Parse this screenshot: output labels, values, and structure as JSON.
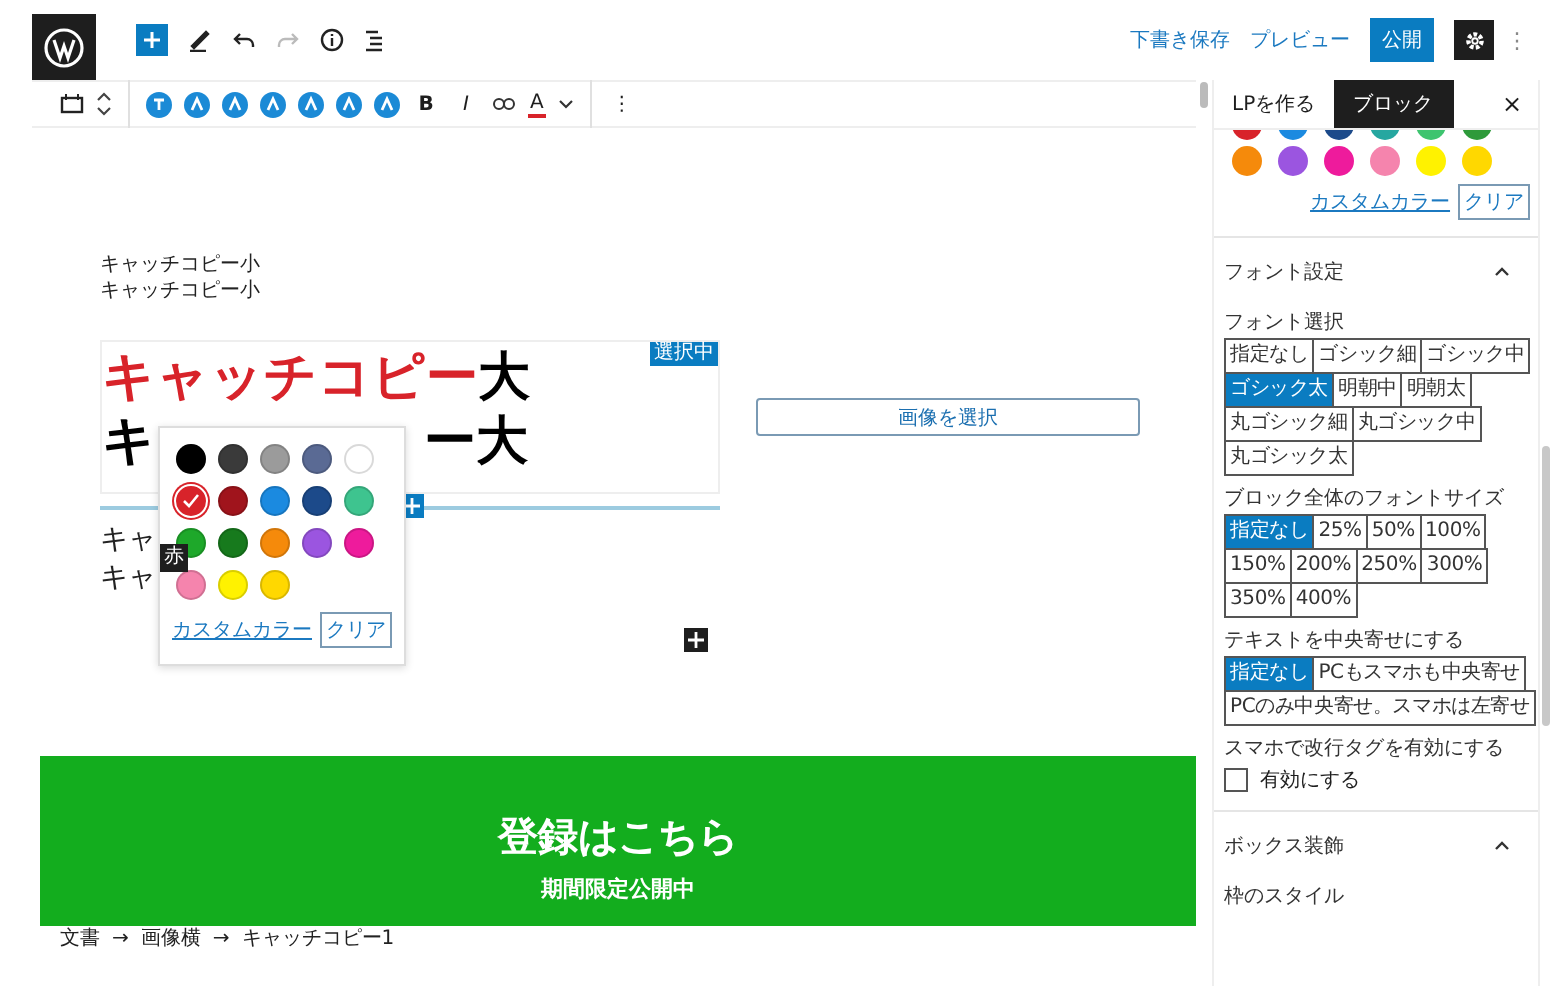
{
  "header": {
    "links": [
      "下書き保存",
      "プレビュー"
    ],
    "publish_button": "公開",
    "more_button": "⋮"
  },
  "toolbar": {
    "format_buttons": [
      {
        "label": "B",
        "kind": "bold"
      },
      {
        "label": "I",
        "kind": "italic"
      }
    ],
    "text_color_button": "A",
    "more_button": "⋮"
  },
  "editor": {
    "small_lines": [
      "キャッチコピー小",
      "キャッチコピー小"
    ],
    "heading": {
      "badge": "選択中",
      "lines": [
        {
          "kind": "full",
          "segments": [
            {
              "text": "キャッチコピー",
              "color": "#d8232a"
            },
            {
              "text": "大"
            }
          ]
        },
        {
          "kind": "covered",
          "segments": [
            {
              "text": "キ"
            },
            {
              "text": "ー大"
            }
          ]
        }
      ]
    },
    "image_button": "画像を選択",
    "lower_lines": [
      "キャ",
      "キャ"
    ],
    "banner": {
      "title": "登録はこちら",
      "subtitle": "期間限定公開中"
    }
  },
  "color_popover": {
    "swatches": [
      {
        "color": "#000000",
        "selected": false
      },
      {
        "color": "#3a3a3a",
        "selected": false
      },
      {
        "color": "#9b9b9b",
        "selected": false
      },
      {
        "color": "#5a6a94",
        "selected": false
      },
      {
        "color": "#ffffff",
        "selected": false
      },
      {
        "color": "#d8232a",
        "selected": true
      },
      {
        "color": "#a0141c",
        "selected": false
      },
      {
        "color": "#1b8ae0",
        "selected": false
      },
      {
        "color": "#1c4a8a",
        "selected": false
      },
      {
        "color": "#3ec48f",
        "selected": false
      },
      {
        "color": "#1ea82a",
        "selected": false
      },
      {
        "color": "#177a1d",
        "selected": false
      },
      {
        "color": "#f58a0b",
        "selected": false
      },
      {
        "color": "#9b55e0",
        "selected": false
      },
      {
        "color": "#ee1b9c",
        "selected": false
      },
      {
        "color": "#f584ad",
        "selected": false
      },
      {
        "color": "#fff200",
        "selected": false
      },
      {
        "color": "#ffd800",
        "selected": false
      }
    ],
    "tooltip": "赤",
    "custom_link": "カスタムカラー",
    "clear_button": "クリア"
  },
  "breadcrumb": [
    "文書",
    "→",
    "画像横",
    "→",
    "キャッチコピー1"
  ],
  "sidebar": {
    "tabs": [
      {
        "label": "LPを作る",
        "selected": false
      },
      {
        "label": "ブロック",
        "selected": true
      }
    ],
    "close_button": "×",
    "partial_colors": [
      {
        "color": "#d8232a"
      },
      {
        "color": "#1b8ae0"
      },
      {
        "color": "#1c4a8a"
      },
      {
        "color": "#26a7a0"
      },
      {
        "color": "#3ec46f"
      },
      {
        "color": "#2e9a3a"
      }
    ],
    "colors": [
      {
        "color": "#f58a0b"
      },
      {
        "color": "#9b55e0"
      },
      {
        "color": "#ee1b9c"
      },
      {
        "color": "#f584ad"
      },
      {
        "color": "#fff200"
      },
      {
        "color": "#ffd800"
      }
    ],
    "custom_link": "カスタムカラー",
    "clear_button": "クリア",
    "font_section": {
      "title": "フォント設定",
      "expanded": true,
      "groups": [
        {
          "label": "フォント選択",
          "options": [
            {
              "label": "指定なし",
              "selected": false
            },
            {
              "label": "ゴシック細",
              "selected": false
            },
            {
              "label": "ゴシック中",
              "selected": false
            },
            {
              "label": "ゴシック太",
              "selected": true
            },
            {
              "label": "明朝中",
              "selected": false
            },
            {
              "label": "明朝太",
              "selected": false
            },
            {
              "label": "丸ゴシック細",
              "selected": false
            },
            {
              "label": "丸ゴシック中",
              "selected": false
            },
            {
              "label": "丸ゴシック太",
              "selected": false
            }
          ]
        },
        {
          "label": "ブロック全体のフォントサイズ",
          "options": [
            {
              "label": "指定なし",
              "selected": true
            },
            {
              "label": "25%",
              "selected": false
            },
            {
              "label": "50%",
              "selected": false
            },
            {
              "label": "100%",
              "selected": false
            },
            {
              "label": "150%",
              "selected": false
            },
            {
              "label": "200%",
              "selected": false
            },
            {
              "label": "250%",
              "selected": false
            },
            {
              "label": "300%",
              "selected": false
            },
            {
              "label": "350%",
              "selected": false
            },
            {
              "label": "400%",
              "selected": false
            }
          ]
        },
        {
          "label": "テキストを中央寄せにする",
          "options": [
            {
              "label": "指定なし",
              "selected": true
            },
            {
              "label": "PCもスマホも中央寄せ",
              "selected": false
            },
            {
              "label": "PCのみ中央寄せ。スマホは左寄せ",
              "selected": false
            }
          ]
        }
      ],
      "checkbox_label": "スマホで改行タグを有効にする",
      "checkbox": {
        "label": "有効にする",
        "checked": false
      }
    },
    "box_section": {
      "title": "ボックス装飾",
      "expanded": true,
      "label": "枠のスタイル"
    }
  }
}
